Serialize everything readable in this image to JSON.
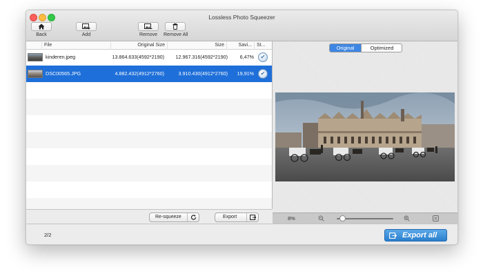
{
  "window": {
    "title": "Lossless Photo Squeezer"
  },
  "toolbar": {
    "back_label": "Back",
    "add_label": "Add",
    "remove_label": "Remove",
    "remove_all_label": "Remove All"
  },
  "table": {
    "headers": {
      "file": "File",
      "original_size": "Original Size",
      "size": "Size",
      "savings": "Savi...",
      "status": "St..."
    },
    "rows": [
      {
        "file": "kinderen.jpeg",
        "original_size": "13.864.633(4592*2190)",
        "size": "12.967.316(4592*2190)",
        "savings": "6,47%",
        "selected": false
      },
      {
        "file": "DSC00565.JPG",
        "original_size": "4.882.432(4912*2760)",
        "size": "3.910.430(4912*2760)",
        "savings": "19,91%",
        "selected": true
      }
    ]
  },
  "actions": {
    "resqueeze_label": "Re-squeeze",
    "export_label": "Export"
  },
  "preview": {
    "tabs": [
      {
        "label": "Original",
        "active": true
      },
      {
        "label": "Optimized",
        "active": false
      }
    ],
    "zoom_label": "8%",
    "zoom_level": 0.05
  },
  "footer": {
    "count": "2/2",
    "export_all_label": "Export all"
  },
  "colors": {
    "selection": "#1e6fd9",
    "accent": "#3d86e3",
    "export_button": "#2a7fcd"
  }
}
